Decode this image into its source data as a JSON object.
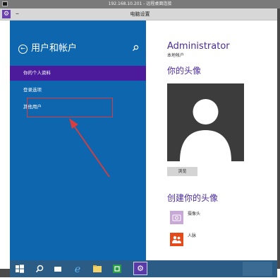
{
  "remote_window": {
    "title": "192.168.10.201 - 远程桌面连接"
  },
  "app_window": {
    "title": "电脑设置",
    "minimize_label": "–"
  },
  "left_pane": {
    "title": "用户和帐户",
    "items": [
      {
        "label": "你的个人资料",
        "selected": true
      },
      {
        "label": "登录选项",
        "selected": false
      },
      {
        "label": "其他用户",
        "selected": false
      }
    ],
    "selected_color": "#4b1b9c",
    "background_color": "#0d66ae"
  },
  "account": {
    "name": "Administrator",
    "type": "本地帐户"
  },
  "avatar_section": {
    "title": "你的头像",
    "browse_label": "浏览"
  },
  "create_section": {
    "title": "创建你的头像",
    "items": [
      {
        "icon": "camera-icon",
        "label": "摄像头"
      },
      {
        "icon": "people-icon",
        "label": "人脉"
      }
    ]
  },
  "annotation": {
    "highlight_color": "#d93d3d"
  },
  "accent_color": "#4b2a9c"
}
